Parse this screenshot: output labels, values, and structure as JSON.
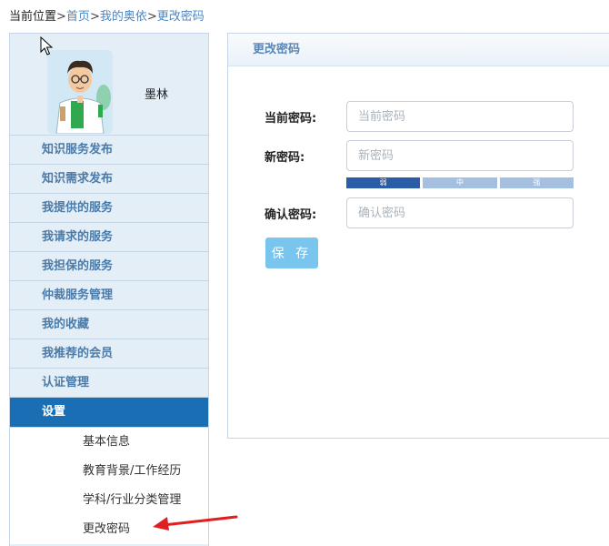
{
  "breadcrumb": {
    "current": "当前位置",
    "home": "首页",
    "sep1": ">",
    "my_section": "我的奥依",
    "sep2": ">",
    "page": "更改密码"
  },
  "profile": {
    "name": "墨林"
  },
  "sidebar": {
    "items": [
      {
        "label": "知识服务发布"
      },
      {
        "label": "知识需求发布"
      },
      {
        "label": "我提供的服务"
      },
      {
        "label": "我请求的服务"
      },
      {
        "label": "我担保的服务"
      },
      {
        "label": "仲裁服务管理"
      },
      {
        "label": "我的收藏"
      },
      {
        "label": "我推荐的会员"
      },
      {
        "label": "认证管理"
      },
      {
        "label": "设置"
      }
    ],
    "sub_items": [
      {
        "label": "基本信息"
      },
      {
        "label": "教育背景/工作经历"
      },
      {
        "label": "学科/行业分类管理"
      },
      {
        "label": "更改密码"
      }
    ]
  },
  "panel": {
    "title": "更改密码",
    "current_password_label": "当前密码:",
    "current_password_placeholder": "当前密码",
    "new_password_label": "新密码:",
    "new_password_placeholder": "新密码",
    "confirm_password_label": "确认密码:",
    "confirm_password_placeholder": "确认密码",
    "strength": {
      "weak": "弱",
      "medium": "中",
      "strong": "强"
    },
    "save_label": "保 存"
  },
  "colors": {
    "accent": "#1a6fb4",
    "sidebar_bg": "#e4eef7",
    "link": "#4a86c5",
    "save_button": "#7ac5ee",
    "arrow": "#e02020"
  }
}
